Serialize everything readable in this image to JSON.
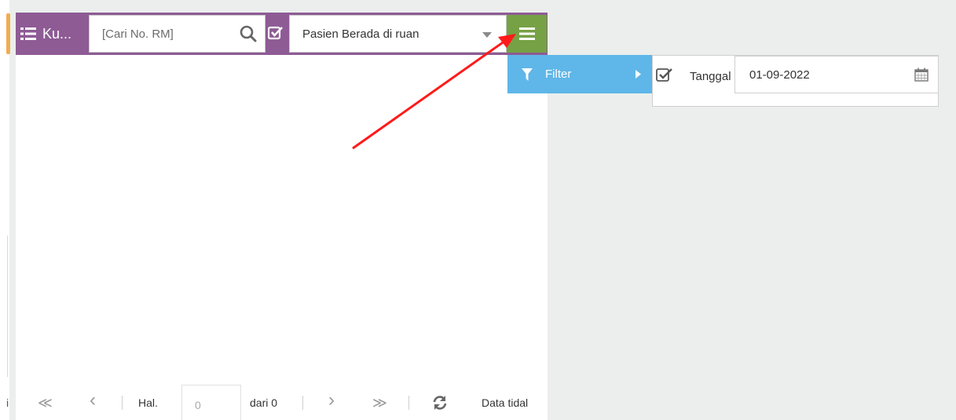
{
  "header": {
    "title": "Ku...",
    "search_placeholder": "[Cari No. RM]",
    "filter_select_value": "Pasien Berada di ruan"
  },
  "menu": {
    "filter_label": "Filter",
    "date_label": "Tanggal",
    "date_value": "01-09-2022"
  },
  "pager": {
    "left_char": "i",
    "first": "≪",
    "prev": "‹",
    "page_label": "Hal.",
    "page_value": "0",
    "of_label": "dari 0",
    "next": "›",
    "last": "≫",
    "status": "Data tidal"
  },
  "icons": {
    "list": "list-icon",
    "search": "search-icon",
    "check": "checkbox-icon",
    "menu": "hamburger-menu-icon",
    "filter": "filter-icon",
    "calendar": "calendar-icon",
    "refresh": "refresh-icon"
  },
  "colors": {
    "toolbar": "#8e5b95",
    "menu_button": "#76a144",
    "filter_highlight": "#5fb6e8",
    "annotation_arrow": "#ff1a1a"
  }
}
